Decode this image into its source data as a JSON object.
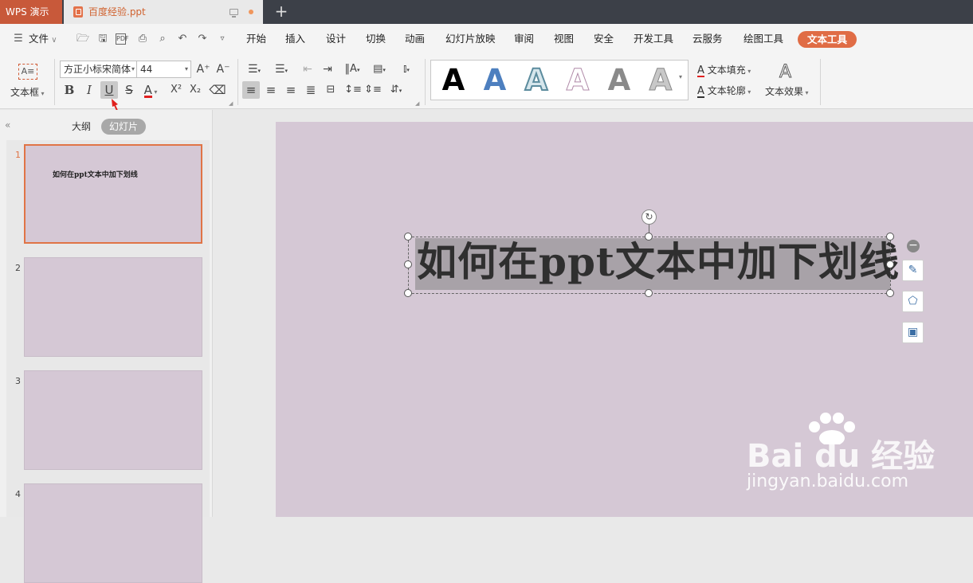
{
  "titlebar": {
    "app_tab": "WPS 演示",
    "doc_tab": "百度经验.ppt",
    "new_tab": "+"
  },
  "menubar": {
    "file_label": "文件",
    "items": [
      "开始",
      "插入",
      "设计",
      "切换",
      "动画",
      "幻灯片放映",
      "审阅",
      "视图",
      "安全",
      "开发工具",
      "云服务",
      "绘图工具"
    ],
    "active": "文本工具"
  },
  "ribbon": {
    "textbox_label": "文本框",
    "font_family": "方正小标宋简体",
    "font_size": "44",
    "grow_font": "A⁺",
    "shrink_font": "A⁻",
    "bold": "B",
    "italic": "I",
    "underline": "U",
    "strike": "S",
    "font_color": "A",
    "superscript": "X²",
    "subscript": "X₂",
    "styles_letter": "A",
    "text_fill": "文本填充",
    "text_outline": "文本轮廓",
    "text_effect": "文本效果"
  },
  "panel": {
    "tab_outline": "大纲",
    "tab_slides": "幻灯片"
  },
  "slides": [
    {
      "number": "1",
      "title": "如何在ppt文本中加下划线"
    },
    {
      "number": "2",
      "title": ""
    },
    {
      "number": "3",
      "title": ""
    },
    {
      "number": "4",
      "title": ""
    }
  ],
  "slide": {
    "title": "如何在ppt文本中加下划线"
  },
  "watermark": {
    "brand": "Bai du 经验",
    "url": "jingyan.baidu.com"
  },
  "colors": {
    "accent": "#e06c45",
    "slide_bg": "#d5c8d5",
    "titlebar": "#3c4048"
  }
}
